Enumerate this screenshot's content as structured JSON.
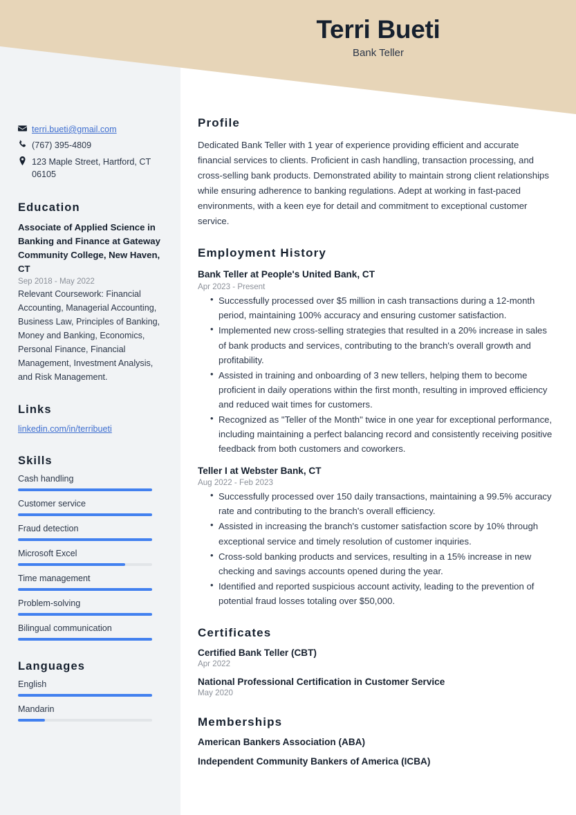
{
  "theme": {
    "header_band": "#e7d5b8",
    "sidebar_bg": "#f1f3f5",
    "accent_bar": "#4280ef",
    "bar_track": "#e2e5e8",
    "link": "#3f6fd0",
    "heading": "#16202e",
    "body_text": "#2b3648",
    "muted_text": "#8b9099"
  },
  "header": {
    "name": "Terri Bueti",
    "job_title": "Bank Teller"
  },
  "contact": {
    "email": "terri.bueti@gmail.com",
    "phone": "(767) 395-4809",
    "address": "123 Maple Street, Hartford, CT 06105",
    "icons": {
      "email": "envelope-icon",
      "phone": "phone-icon",
      "address": "location-pin-icon"
    }
  },
  "education": {
    "heading": "Education",
    "entries": [
      {
        "degree": "Associate of Applied Science in Banking and Finance at Gateway Community College, New Haven, CT",
        "dates": "Sep 2018 - May 2022",
        "description": "Relevant Coursework: Financial Accounting, Managerial Accounting, Business Law, Principles of Banking, Money and Banking, Economics, Personal Finance, Financial Management, Investment Analysis, and Risk Management."
      }
    ]
  },
  "links": {
    "heading": "Links",
    "items": [
      {
        "label": "linkedin.com/in/terribueti"
      }
    ]
  },
  "skills": {
    "heading": "Skills",
    "items": [
      {
        "label": "Cash handling",
        "level": 100
      },
      {
        "label": "Customer service",
        "level": 100
      },
      {
        "label": "Fraud detection",
        "level": 100
      },
      {
        "label": "Microsoft Excel",
        "level": 80
      },
      {
        "label": "Time management",
        "level": 100
      },
      {
        "label": "Problem-solving",
        "level": 100
      },
      {
        "label": "Bilingual communication",
        "level": 100
      }
    ]
  },
  "languages": {
    "heading": "Languages",
    "items": [
      {
        "label": "English",
        "level": 100
      },
      {
        "label": "Mandarin",
        "level": 20
      }
    ]
  },
  "profile": {
    "heading": "Profile",
    "text": "Dedicated Bank Teller with 1 year of experience providing efficient and accurate financial services to clients. Proficient in cash handling, transaction processing, and cross-selling bank products. Demonstrated ability to maintain strong client relationships while ensuring adherence to banking regulations. Adept at working in fast-paced environments, with a keen eye for detail and commitment to exceptional customer service."
  },
  "employment": {
    "heading": "Employment History",
    "entries": [
      {
        "title": "Bank Teller at People's United Bank, CT",
        "dates": "Apr 2023 - Present",
        "bullets": [
          "Successfully processed over $5 million in cash transactions during a 12-month period, maintaining 100% accuracy and ensuring customer satisfaction.",
          "Implemented new cross-selling strategies that resulted in a 20% increase in sales of bank products and services, contributing to the branch's overall growth and profitability.",
          "Assisted in training and onboarding of 3 new tellers, helping them to become proficient in daily operations within the first month, resulting in improved efficiency and reduced wait times for customers.",
          "Recognized as \"Teller of the Month\" twice in one year for exceptional performance, including maintaining a perfect balancing record and consistently receiving positive feedback from both customers and coworkers."
        ]
      },
      {
        "title": "Teller I at Webster Bank, CT",
        "dates": "Aug 2022 - Feb 2023",
        "bullets": [
          "Successfully processed over 150 daily transactions, maintaining a 99.5% accuracy rate and contributing to the branch's overall efficiency.",
          "Assisted in increasing the branch's customer satisfaction score by 10% through exceptional service and timely resolution of customer inquiries.",
          "Cross-sold banking products and services, resulting in a 15% increase in new checking and savings accounts opened during the year.",
          "Identified and reported suspicious account activity, leading to the prevention of potential fraud losses totaling over $50,000."
        ]
      }
    ]
  },
  "certificates": {
    "heading": "Certificates",
    "entries": [
      {
        "name": "Certified Bank Teller (CBT)",
        "date": "Apr 2022"
      },
      {
        "name": "National Professional Certification in Customer Service",
        "date": "May 2020"
      }
    ]
  },
  "memberships": {
    "heading": "Memberships",
    "entries": [
      {
        "name": "American Bankers Association (ABA)"
      },
      {
        "name": "Independent Community Bankers of America (ICBA)"
      }
    ]
  }
}
